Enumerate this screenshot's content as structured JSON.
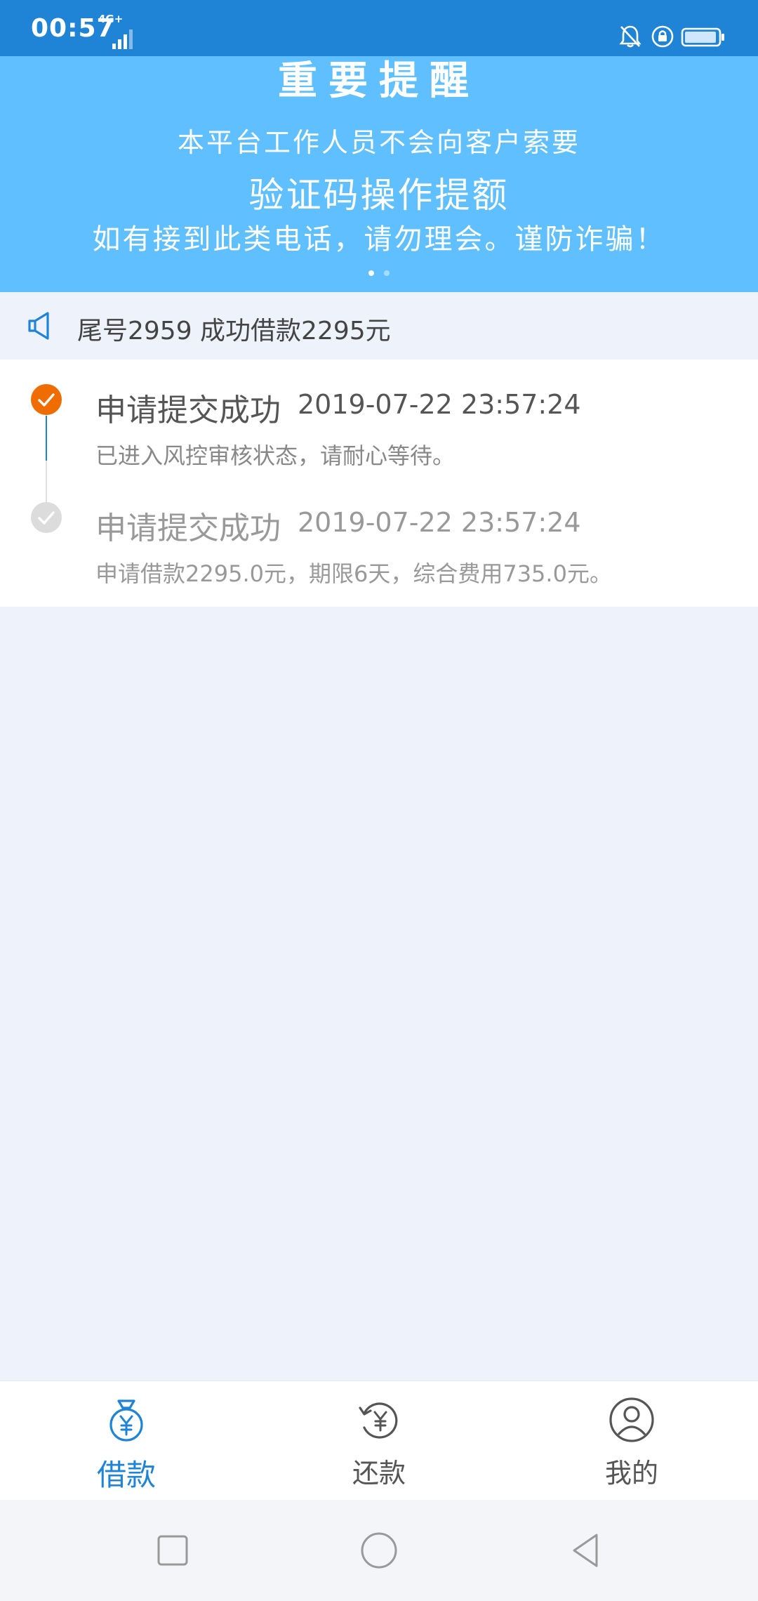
{
  "status_bar": {
    "time": "00:57",
    "network": "4G+",
    "icons": [
      "signal-icon",
      "bell-icon",
      "rotate-lock-icon",
      "battery-icon"
    ]
  },
  "banner": {
    "title": "重要提醒",
    "line1": "本平台工作人员不会向客户索要",
    "line2": "验证码操作提额",
    "line3": "如有接到此类电话，请勿理会。谨防诈骗！",
    "dots": 2,
    "active_dot": 0
  },
  "notice": {
    "icon": "speaker-icon",
    "text": "尾号2959 成功借款2295元"
  },
  "timeline": [
    {
      "title": "申请提交成功",
      "time": "2019-07-22 23:57:24",
      "desc": "已进入风控审核状态，请耐心等待。",
      "status": "active"
    },
    {
      "title": "申请提交成功",
      "time": "2019-07-22 23:57:24",
      "desc": "申请借款2295.0元，期限6天，综合费用735.0元。",
      "status": "done"
    }
  ],
  "bottom_nav": [
    {
      "label": "借款",
      "icon": "loan-bag-icon",
      "active": true
    },
    {
      "label": "还款",
      "icon": "repay-icon",
      "active": false
    },
    {
      "label": "我的",
      "icon": "profile-icon",
      "active": false
    }
  ],
  "colors": {
    "primary": "#1f84d6",
    "banner": "#5fbfff",
    "active_step": "#ef6c00",
    "background": "#eef2fa"
  }
}
